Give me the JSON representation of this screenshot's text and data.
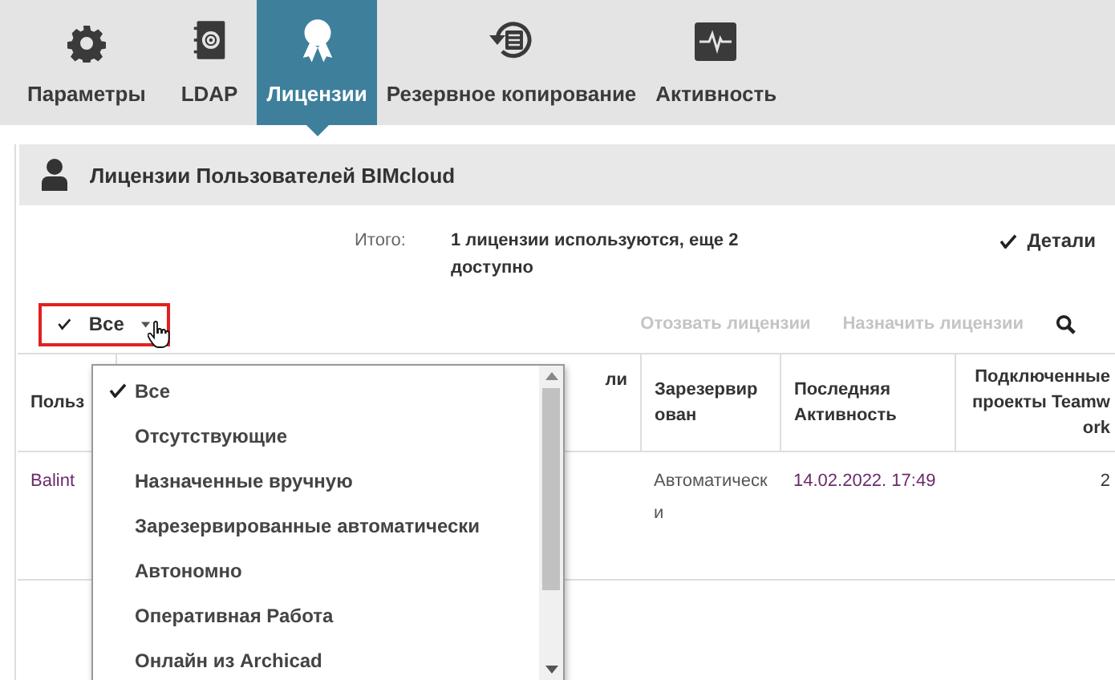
{
  "tabs": [
    {
      "label": "Параметры",
      "selected": false
    },
    {
      "label": "LDAP",
      "selected": false
    },
    {
      "label": "Лицензии",
      "selected": true
    },
    {
      "label": "Резервное копирование",
      "selected": false
    },
    {
      "label": "Активность",
      "selected": false
    }
  ],
  "panel": {
    "title": "Лицензии Пользователей BIMcloud"
  },
  "summary": {
    "label": "Итого:",
    "value": "1 лицензии используются, еще 2 доступно"
  },
  "details": {
    "label": "Детали",
    "checked": true
  },
  "filter": {
    "label": "Все"
  },
  "actions": [
    {
      "label": "Отозвать лицензии",
      "disabled": true
    },
    {
      "label": "Назначить лицензии",
      "disabled": true
    }
  ],
  "table": {
    "columns": [
      "Польз",
      "ли",
      "Зарезервирован",
      "Последняя Активность",
      "Подключенные проекты Teamwork"
    ],
    "rows": [
      {
        "cells": [
          "Balint",
          "",
          "Автоматически",
          "14.02.2022. 17:49",
          "2"
        ]
      }
    ]
  },
  "dropdown": {
    "items": [
      {
        "label": "Все",
        "selected": true
      },
      {
        "label": "Отсутствующие",
        "selected": false
      },
      {
        "label": "Назначенные вручную",
        "selected": false
      },
      {
        "label": "Зарезервированные автоматически",
        "selected": false
      },
      {
        "label": "Автономно",
        "selected": false
      },
      {
        "label": "Оперативная Работа",
        "selected": false
      },
      {
        "label": "Онлайн из Archicad",
        "selected": false
      }
    ]
  }
}
